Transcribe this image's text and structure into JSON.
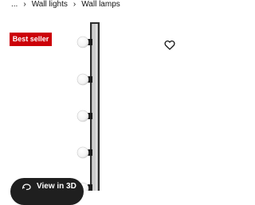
{
  "breadcrumb": {
    "ellipsis": "...",
    "items": [
      {
        "label": "Wall lights"
      },
      {
        "label": "Wall lamps"
      }
    ],
    "separator_icon": "chevron-right-icon"
  },
  "badge": {
    "label": "Best seller",
    "color": "#cc0008"
  },
  "favourite": {
    "icon": "heart-icon"
  },
  "product": {
    "bulb_count": 5
  },
  "view3d": {
    "label": "View in 3D",
    "icon": "rotate-3d-icon"
  }
}
